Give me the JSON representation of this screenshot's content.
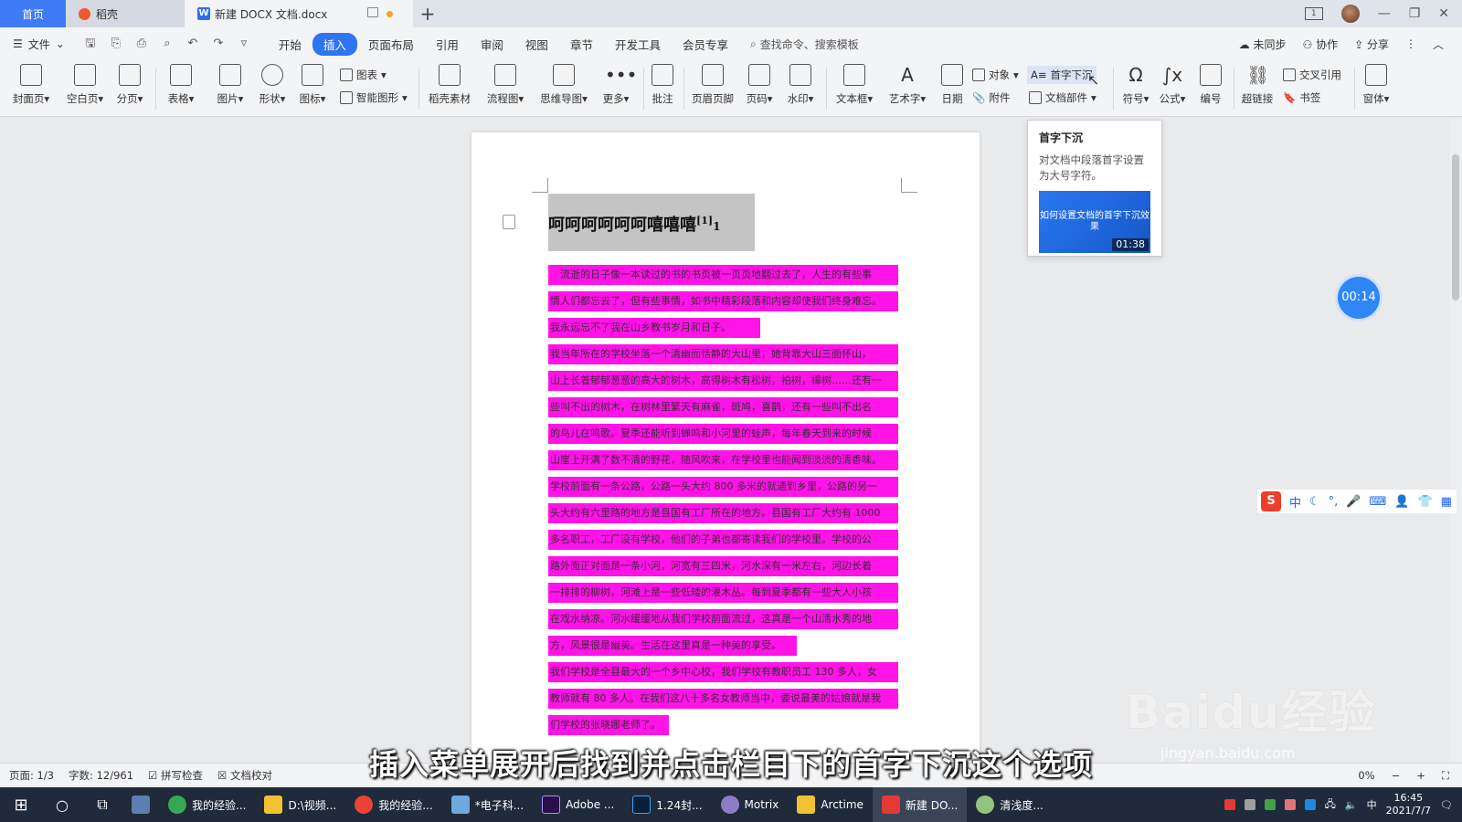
{
  "titlebar": {
    "tabs": [
      {
        "label": "首页"
      },
      {
        "label": "稻壳"
      },
      {
        "label": "新建 DOCX 文档.docx"
      }
    ],
    "new_tab": "+"
  },
  "menubar": {
    "file": "文件",
    "items": [
      "开始",
      "插入",
      "页面布局",
      "引用",
      "审阅",
      "视图",
      "章节",
      "开发工具",
      "会员专享"
    ],
    "active": "插入",
    "search": "查找命令、搜索模板",
    "right": [
      "未同步",
      "协作",
      "分享"
    ]
  },
  "ribbon": {
    "cover": "封面页",
    "blank": "空白页",
    "pagebreak": "分页",
    "table": "表格",
    "picture": "图片",
    "shape": "形状",
    "icon": "图标",
    "chart": "图表",
    "smartart": "智能图形",
    "daoke": "稻壳素材",
    "flowchart": "流程图",
    "mindmap": "思维导图",
    "more": "更多",
    "comment": "批注",
    "header_footer": "页眉页脚",
    "page_num": "页码",
    "watermark": "水印",
    "textbox": "文本框",
    "wordart": "艺术字",
    "date": "日期",
    "object": "对象",
    "attachment": "附件",
    "dropcap": "首字下沉",
    "docparts": "文档部件",
    "symbol": "符号",
    "formula": "公式",
    "numbering": "编号",
    "hyperlink": "超链接",
    "crossref": "交叉引用",
    "bookmark": "书签",
    "form": "窗体"
  },
  "document": {
    "title": "呵呵呵呵呵呵嘻嘻嘻",
    "title_note": "[1]",
    "title_tail": "1",
    "lines": [
      "　流逝的日子像一本读过的书的书页被一页页地翻过去了，人生的有些事",
      "情人们都忘去了，但有些事情，如书中精彩段落和内容却使我们终身难忘。",
      "我永远忘不了我在山乡教书岁月和日子。",
      "我当年所在的学校坐落一个清幽而恬静的大山里，她背靠大山三面怀山，",
      "山上长着郁郁葱葱的高大的树木，高得树木有松树，柏树，樟树……还有一",
      "些叫不出的树木，在树林里繁天有麻雀，斑鸠，喜鹊，还有一些叫不出名",
      "的鸟儿在鸣歌。夏季还能听到蝉鸣和小河里的蛙声，每年春天到来的时候",
      "山崖上开满了数不清的野花，随风吹来，在学校里也能闻到淡淡的清香味。",
      "学校前面有一条公路，公路一头大约 800 多米的就通到乡里，公路的另一",
      "头大约有六里路的地方是县国有工厂所在的地方。县国有工厂大约有 1000",
      "多名职工，工厂没有学校，他们的子弟也都寄读我们的学校里。学校的公",
      "路外面正对面是一条小河，河宽有三四米，河水深有一米左右，河边长着",
      "一排排的柳树，河滩上是一些低矮的灌木丛。每到夏季都有一些大人小孩",
      "在戏水纳凉。河水缓缓地从我们学校前面流过，这真是一个山清水秀的地",
      "方，风景很是幽美。生活在这里真是一种美的享受。",
      "我们学校是全县最大的一个乡中心校，我们学校有教职员工 130 多人，女",
      "教师就有 80 多人。在我们这八十多名女教师当中，要说最美的姑娘就是我",
      "们学校的张晓娜老师了。"
    ]
  },
  "tooltip": {
    "title": "首字下沉",
    "desc": "对文档中段落首字设置为大号字符。",
    "video_text": "如何设置文档的首字下沉效果",
    "duration": "01:38"
  },
  "timer": "00:14",
  "ime": {
    "lang": "中"
  },
  "statusbar": {
    "page": "页面: 1/3",
    "words": "字数: 12/961",
    "spell": "拼写检查",
    "proof": "文档校对",
    "zoom": "0%"
  },
  "subtitle": "插入菜单展开后找到并点击栏目下的首字下沉这个选项",
  "watermark": {
    "brand": "Baidu经验",
    "url": "jingyan.baidu.com"
  },
  "taskbar": {
    "apps": [
      "我的经验...",
      "D:\\视频...",
      "我的经验...",
      "*电子科...",
      "Adobe ...",
      "1.24封...",
      "Motrix",
      "Arctime",
      "新建 DO...",
      "清浅度..."
    ],
    "ime": "中",
    "time": "16:45",
    "date": "2021/7/7"
  },
  "colors": {
    "accent": "#2f74f0",
    "highlight": "#ff13e7",
    "title_shade": "#c4c4c4"
  }
}
